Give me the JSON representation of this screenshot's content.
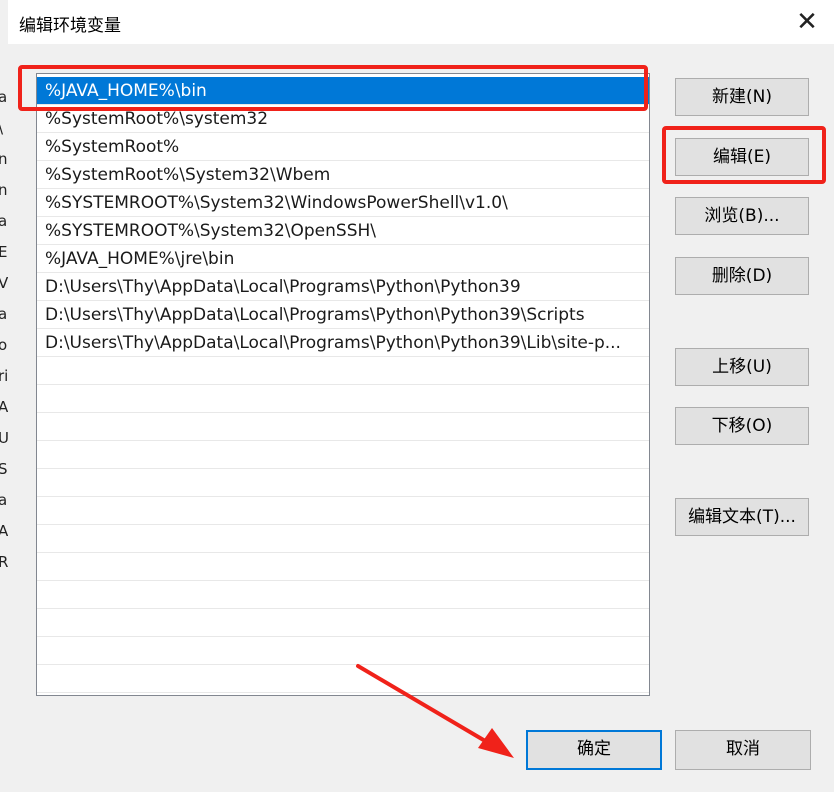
{
  "background_fragments": [
    "a",
    "\\",
    "n",
    "n",
    "a",
    "E",
    "V",
    "a",
    "o",
    "ri",
    "A",
    "U",
    "S",
    "a",
    "A",
    "R"
  ],
  "dialog": {
    "title": "编辑环境变量",
    "close_glyph": "✕"
  },
  "path_list": {
    "items": [
      "%JAVA_HOME%\\bin",
      "%SystemRoot%\\system32",
      "%SystemRoot%",
      "%SystemRoot%\\System32\\Wbem",
      "%SYSTEMROOT%\\System32\\WindowsPowerShell\\v1.0\\",
      "%SYSTEMROOT%\\System32\\OpenSSH\\",
      "%JAVA_HOME%\\jre\\bin",
      "D:\\Users\\Thy\\AppData\\Local\\Programs\\Python\\Python39",
      "D:\\Users\\Thy\\AppData\\Local\\Programs\\Python\\Python39\\Scripts",
      "D:\\Users\\Thy\\AppData\\Local\\Programs\\Python\\Python39\\Lib\\site-p..."
    ],
    "selected_index": 0,
    "empty_rows": 12
  },
  "buttons": {
    "new": "新建(N)",
    "edit": "编辑(E)",
    "browse": "浏览(B)...",
    "delete": "删除(D)",
    "move_up": "上移(U)",
    "move_down": "下移(O)",
    "edit_text": "编辑文本(T)...",
    "ok": "确定",
    "cancel": "取消"
  },
  "colors": {
    "selection": "#0078d7",
    "annotation": "#f0221a"
  }
}
